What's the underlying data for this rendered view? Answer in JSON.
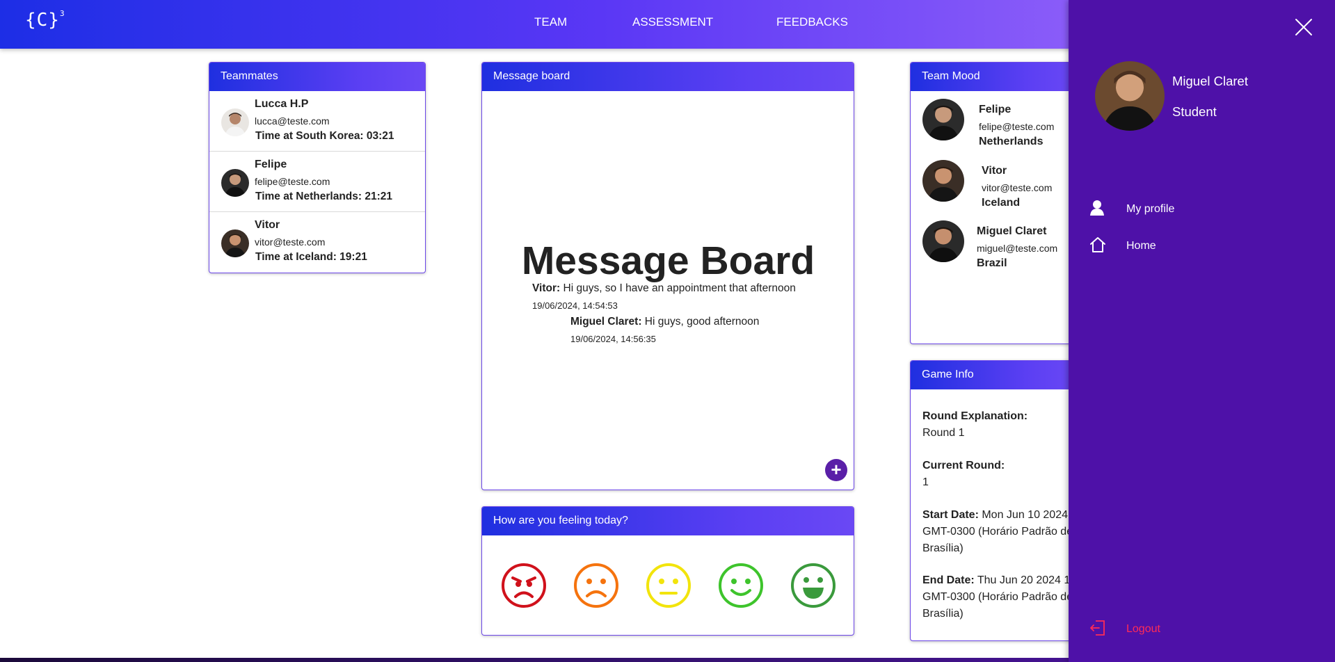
{
  "app": {
    "logo": "{C}",
    "logo_sup": "3"
  },
  "nav": {
    "items": [
      "TEAM",
      "ASSESSMENT",
      "FEEDBACKS"
    ]
  },
  "teammates": {
    "title": "Teammates",
    "people": [
      {
        "name": "Lucca H.P",
        "email": "lucca@teste.com",
        "time": "Time at South Korea: 03:21"
      },
      {
        "name": "Felipe",
        "email": "felipe@teste.com",
        "time": "Time at Netherlands: 21:21"
      },
      {
        "name": "Vitor",
        "email": "vitor@teste.com",
        "time": "Time at Iceland: 19:21"
      }
    ]
  },
  "message_board": {
    "title": "Message board",
    "heading": "Message Board",
    "messages": [
      {
        "author": "Vitor:",
        "text": " Hi guys, so I have an appointment that afternoon",
        "date": "19/06/2024, 14:54:53"
      },
      {
        "author": "Miguel Claret:",
        "text": " Hi guys, good afternoon",
        "date": "19/06/2024, 14:56:35"
      }
    ],
    "add_label": "+"
  },
  "feeling": {
    "title": "How are you feeling today?",
    "faces": [
      {
        "icon": "angry-face-icon",
        "color": "#d0111b"
      },
      {
        "icon": "sad-face-icon",
        "color": "#f5730e"
      },
      {
        "icon": "neutral-face-icon",
        "color": "#f2e40c"
      },
      {
        "icon": "smile-face-icon",
        "color": "#3ec42c"
      },
      {
        "icon": "happy-face-icon",
        "color": "#3a9a3c"
      }
    ]
  },
  "team_mood": {
    "title": "Team Mood",
    "members": [
      {
        "name": "Felipe",
        "email": "felipe@teste.com",
        "country": "Netherlands"
      },
      {
        "name": "Vitor",
        "email": "vitor@teste.com",
        "country": "Iceland"
      },
      {
        "name": "Miguel Claret",
        "email": "miguel@teste.com",
        "country": "Brazil"
      }
    ]
  },
  "game_info": {
    "title": "Game Info",
    "round_explanation_label": "Round Explanation:",
    "round_explanation": "Round 1",
    "current_round_label": "Current Round:",
    "current_round": "1",
    "start_date_label": "Start Date:",
    "start_date_line1": " Mon Jun 10 2024",
    "start_date_line2": "GMT-0300 (Horário Padrão de",
    "start_date_line3": "Brasília)",
    "end_date_label": "End Date:",
    "end_date_line1": " Thu Jun 20 2024 1",
    "end_date_line2": "GMT-0300 (Horário Padrão de",
    "end_date_line3": "Brasília)"
  },
  "drawer": {
    "user_name": "Miguel Claret",
    "user_role": "Student",
    "items": [
      {
        "label": "My profile",
        "icon": "user-icon"
      },
      {
        "label": "Home",
        "icon": "home-icon"
      }
    ],
    "logout": "Logout"
  },
  "colors": {
    "brand_blue": "#1d2ee6",
    "brand_purple": "#5a37f5",
    "drawer_bg": "#4e11a8",
    "logout": "#ff2b56"
  }
}
